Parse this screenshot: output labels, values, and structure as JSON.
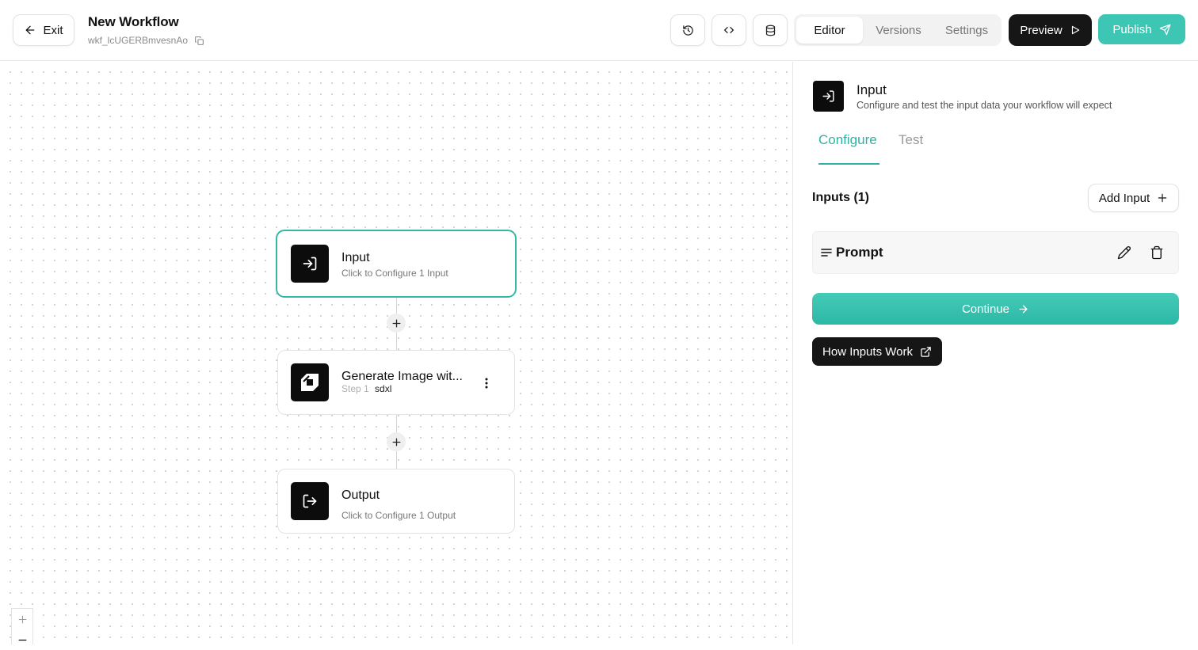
{
  "header": {
    "exit_label": "Exit",
    "workflow_title": "New Workflow",
    "workflow_id": "wkf_lcUGERBmvesnAo",
    "tabs": [
      {
        "label": "Editor",
        "active": true
      },
      {
        "label": "Versions",
        "active": false
      },
      {
        "label": "Settings",
        "active": false
      }
    ],
    "preview_label": "Preview",
    "publish_label": "Publish",
    "icons": [
      "history-icon",
      "code-icon",
      "database-icon"
    ]
  },
  "canvas": {
    "nodes": [
      {
        "title": "Input",
        "subtitle": "Click to Configure 1 Input",
        "icon": "input-arrow-icon",
        "selected": true
      },
      {
        "title": "Generate Image wit...",
        "step": "Step 1",
        "model": "sdxl",
        "icon": "sdxl-logo-icon"
      },
      {
        "title": "Output",
        "subtitle": "Click to Configure 1 Output",
        "icon": "output-arrow-icon"
      }
    ],
    "zoom_in": "+",
    "zoom_out": "−"
  },
  "panel": {
    "title": "Input",
    "subtitle": "Configure and test the input data your workflow will expect",
    "tabs": [
      {
        "label": "Configure",
        "active": true
      },
      {
        "label": "Test",
        "active": false
      }
    ],
    "inputs_label": "Inputs (1)",
    "add_input_label": "Add Input",
    "inputs": [
      {
        "name": "Prompt",
        "type_icon": "text-lines-icon"
      }
    ],
    "continue_label": "Continue",
    "how_label": "How Inputs Work"
  },
  "colors": {
    "accent": "#35b8a6",
    "dark": "#161616"
  }
}
